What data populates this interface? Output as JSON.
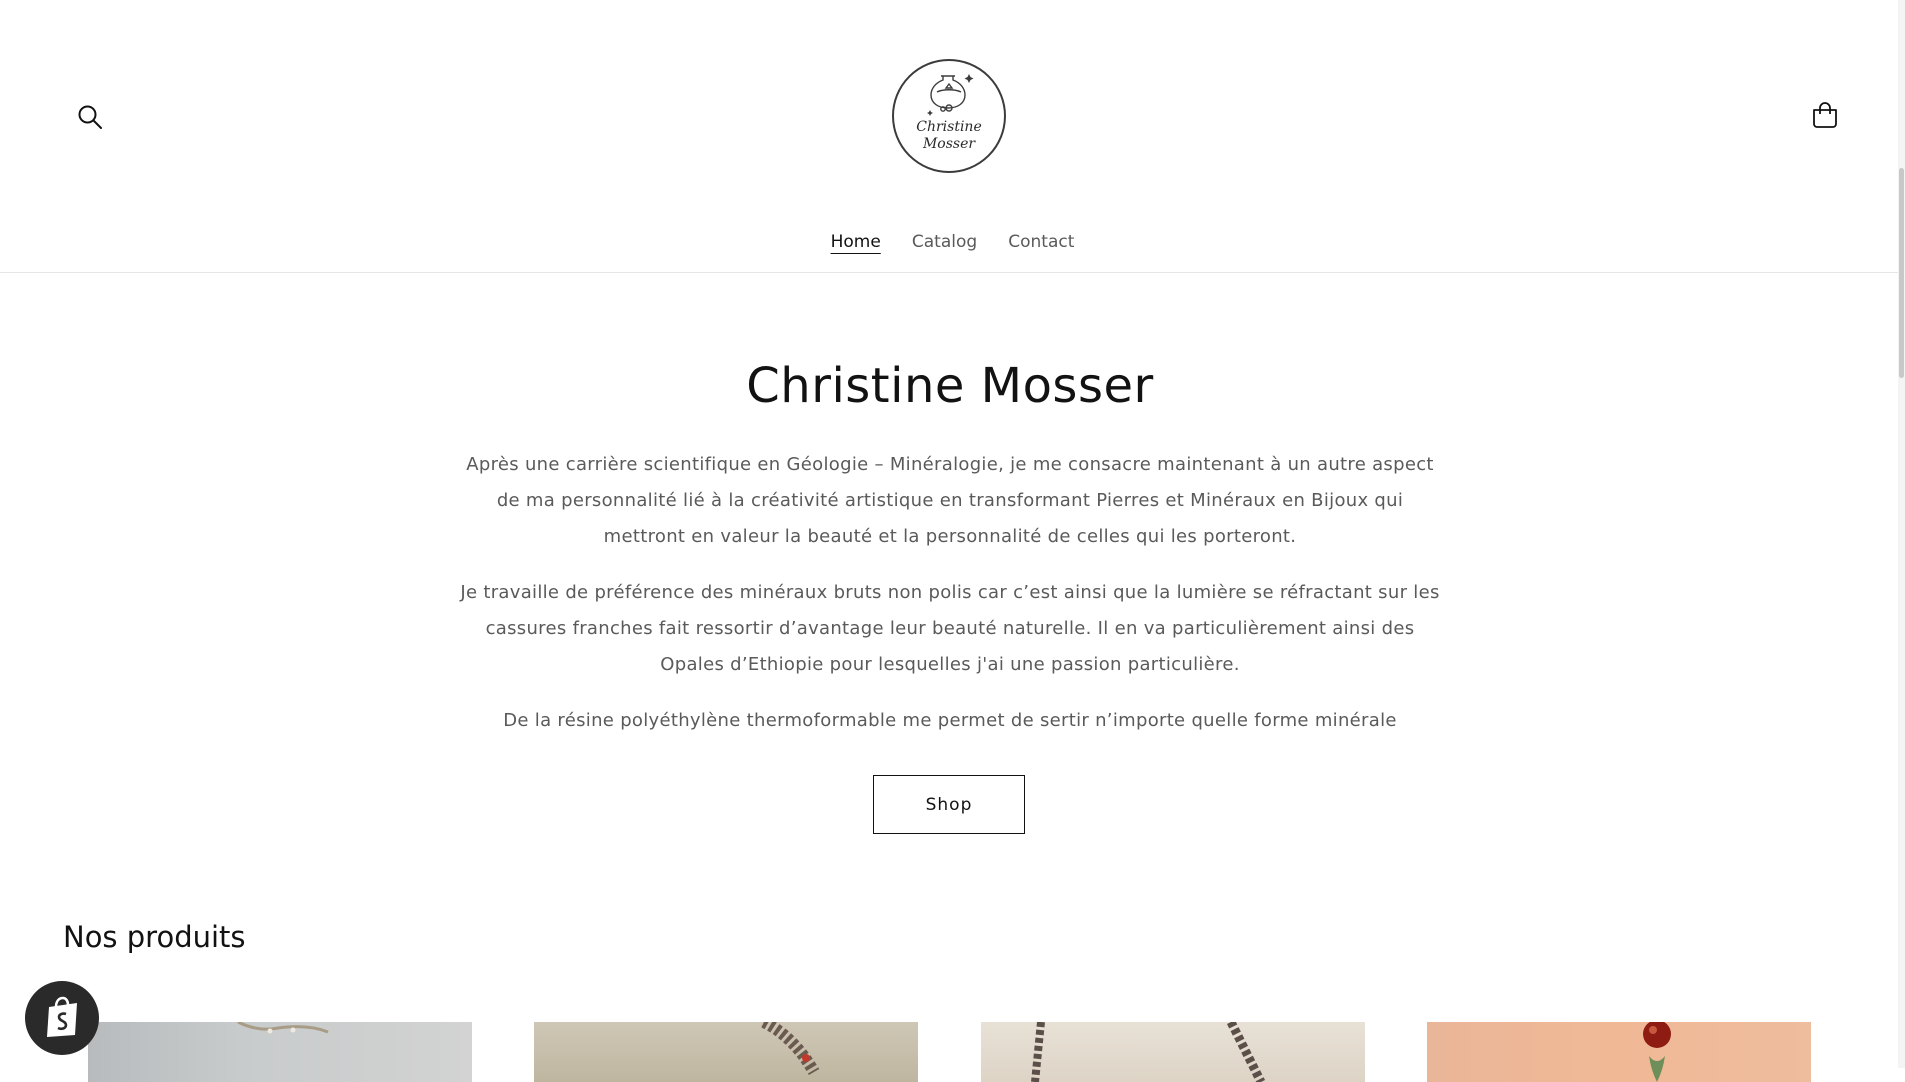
{
  "header": {
    "logo_line1": "Christine",
    "logo_line2": "Mosser"
  },
  "nav": {
    "items": [
      {
        "label": "Home",
        "active": true
      },
      {
        "label": "Catalog",
        "active": false
      },
      {
        "label": "Contact",
        "active": false
      }
    ]
  },
  "hero": {
    "title": "Christine Mosser",
    "paragraph1": "Après une carrière scientifique en Géologie – Minéralogie, je me consacre maintenant à un autre aspect de ma personnalité lié à la créativité artistique en transformant Pierres et Minéraux en Bijoux qui mettront en valeur la beauté et la personnalité de celles qui les porteront.",
    "paragraph2": "Je travaille de préférence des minéraux bruts non polis car c’est ainsi que la lumière se réfractant sur les cassures franches fait ressortir d’avantage leur beauté naturelle. Il en va particulièrement ainsi des Opales d’Ethiopie pour lesquelles j'ai une passion particulière.",
    "paragraph3": "De la résine polyéthylène thermoformable me permet de sertir n’importe quelle forme minérale",
    "button_label": "Shop"
  },
  "products": {
    "title": "Nos produits"
  },
  "icons": {
    "search": "search-icon",
    "cart": "cart-icon",
    "shopify": "shopify-bag-icon"
  },
  "colors": {
    "text": "#121212",
    "muted": "#5a5a5a",
    "background": "#ffffff",
    "badge": "#2a2a2a"
  }
}
